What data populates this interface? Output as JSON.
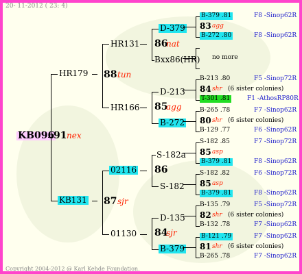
{
  "header": {
    "date": "20- 11-2012 ( 23: 4)"
  },
  "footer": {
    "copyright": "Copyright 2004-2012 @ Karl Kehde Foundation."
  },
  "root": {
    "id": "KB096",
    "value": "91",
    "code": "nex"
  },
  "gen1": {
    "top": {
      "id": "HR179"
    },
    "bottom": {
      "id": "KB131"
    }
  },
  "gen2": {
    "a": {
      "value": "88",
      "code": "tun",
      "top": "HR131",
      "bottom": "HR166"
    },
    "b": {
      "value": "87",
      "code": "sjr",
      "top": "02116",
      "bottom": "01130"
    }
  },
  "gen3": {
    "a": {
      "value": "86",
      "code": "nat",
      "top": "D-379",
      "bottom": "Bxx86(HR)"
    },
    "b": {
      "value": "85",
      "code": "agg",
      "top": "D-213",
      "bottom": "B-272"
    },
    "c": {
      "value": "86",
      "code": "",
      "top": "S-182a",
      "bottom": "S-182"
    },
    "d": {
      "value": "84",
      "code": "sjr",
      "top": "D-135",
      "bottom": "B-379"
    }
  },
  "gen4": [
    {
      "value": "83",
      "code": "agg",
      "sister": "",
      "top": "B-379 .81",
      "top_loc": "F8 -Sinop62R",
      "bottom": "B-272 .80",
      "bottom_loc": "F8 -Sinop62R"
    },
    {
      "value": "",
      "code": "",
      "sister": "no more",
      "top": "",
      "top_loc": "",
      "bottom": "",
      "bottom_loc": ""
    },
    {
      "value": "84",
      "code": "shr",
      "sister": "(6 sister colonies)",
      "top": "B-213 .80",
      "top_loc": "F5 -Sinop72R",
      "bottom": "T-301 .81",
      "bottom_loc": "F1 -AthosRP80R"
    },
    {
      "value": "80",
      "code": "shr",
      "sister": "(6 sister colonies)",
      "top": "B-265 .78",
      "top_loc": "F7 -Sinop62R",
      "bottom": "B-129 .77",
      "bottom_loc": "F6 -Sinop62R"
    },
    {
      "value": "85",
      "code": "asp",
      "sister": "",
      "top": "S-182 .85",
      "top_loc": "F7 -Sinop72R",
      "bottom": "B-379 .81",
      "bottom_loc": "F8 -Sinop62R"
    },
    {
      "value": "85",
      "code": "asp",
      "sister": "",
      "top": "S-182 .82",
      "top_loc": "F6 -Sinop72R",
      "bottom": "B-379 .81",
      "bottom_loc": "F8 -Sinop62R"
    },
    {
      "value": "82",
      "code": "shr",
      "sister": "(6 sister colonies)",
      "top": "B-135 .79",
      "top_loc": "F5 -Sinop72R",
      "bottom": "B-132 .78",
      "bottom_loc": "F7 -Sinop62R"
    },
    {
      "value": "81",
      "code": "shr",
      "sister": "(6 sister colonies)",
      "top": "B-121 .79",
      "top_loc": "F7 -Sinop62R",
      "bottom": "B-265 .78",
      "bottom_loc": "F7 -Sinop62R"
    }
  ],
  "colors": {
    "border": "#ff44cc",
    "background": "#ffffee",
    "highlight_cyan": "#22e5ef",
    "highlight_green": "#22dd22",
    "root_highlight": "#ffccff",
    "code_red": "#ff2200",
    "loc_blue": "#2222cc"
  }
}
